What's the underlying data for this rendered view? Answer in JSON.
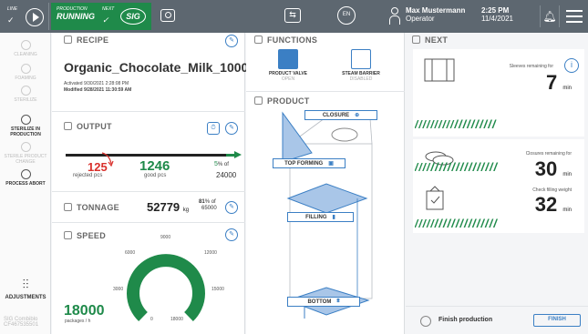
{
  "topbar": {
    "line_label": "LINE",
    "prod_label": "PRODUCTION",
    "prod_state": "RUNNING",
    "next_label": "NEXT",
    "sig_label": "SIG",
    "globe_label": "EN",
    "user_name": "Max Mustermann",
    "user_role": "Operator",
    "time": "2:25 PM",
    "date": "11/4/2021"
  },
  "sidebar": {
    "items": [
      {
        "label": "CLEANING"
      },
      {
        "label": "FOAMING"
      },
      {
        "label": "STERILIZE"
      },
      {
        "label": "STERILIZE IN PRODUCTION"
      },
      {
        "label": "STERILE PRODUCT CHANGE"
      },
      {
        "label": "PROCESS ABORT"
      }
    ],
    "adjustments": "ADJUSTMENTS",
    "footer_line1": "SIG Combiblo",
    "footer_line2": "CF467535501"
  },
  "recipe": {
    "title": "RECIPE",
    "name": "Organic_Chocolate_Milk_1000ml",
    "activated_label": "Activated",
    "activated": "9/30/2021 2:28:08 PM",
    "modified_label": "Modified",
    "modified": "9/28/2021 11:30:59 AM"
  },
  "output": {
    "title": "OUTPUT",
    "rejected": "125",
    "rejected_label": "rejected pcs",
    "good": "1246",
    "good_label": "good pcs",
    "percent": "5",
    "percent_suffix": "% of",
    "target": "24000",
    "progress_fraction": 0.05
  },
  "tonnage": {
    "title": "TONNAGE",
    "value": "52779",
    "unit": "kg",
    "percent": "81",
    "percent_suffix": "% of",
    "target": "65000"
  },
  "speed": {
    "title": "SPEED",
    "value": "18000",
    "unit": "packages / h",
    "ticks": {
      "t0": "0",
      "t3000": "3000",
      "t6000": "6000",
      "t9000": "9000",
      "t12000": "12000",
      "t15000": "15000",
      "t18000": "18000"
    }
  },
  "functions": {
    "title": "FUNCTIONS",
    "valve_label": "PRODUCT VALVE",
    "valve_state": "OPEN",
    "barrier_label": "STEAM BARRIER",
    "barrier_state": "DISABLED"
  },
  "product": {
    "title": "PRODUCT",
    "tags": {
      "closure": "CLOSURE",
      "top_forming": "TOP FORMING",
      "filling": "FILLING",
      "bottom": "BOTTOM"
    }
  },
  "next": {
    "title": "NEXT",
    "cards": [
      {
        "title": "Sleeves remaining for",
        "value": "7",
        "unit": "min"
      },
      {
        "title": "Closures remaining for",
        "value": "30",
        "unit": "min"
      },
      {
        "title": "Check filling weight",
        "value": "32",
        "unit": "min"
      }
    ],
    "finish_label": "Finish production",
    "finish_button": "FINISH"
  },
  "colors": {
    "accent": "#3b7fc4",
    "green": "#1f8a4a",
    "reject": "#d9302c",
    "topbar": "#5d6770"
  }
}
